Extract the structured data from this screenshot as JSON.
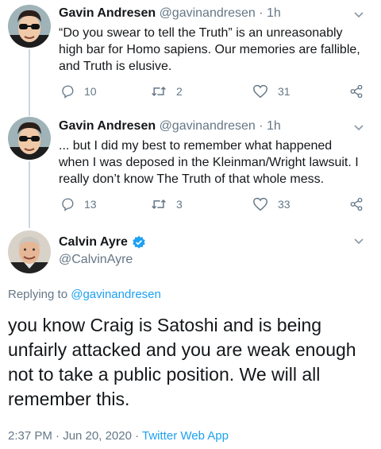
{
  "tweets": [
    {
      "name": "Gavin Andresen",
      "handle": "@gavinandresen",
      "sep": "·",
      "time": "1h",
      "text": "“Do you swear to tell the Truth” is an unreasonably high bar for Homo sapiens. Our memories are fallible, and Truth is elusive.",
      "replies": "10",
      "retweets": "2",
      "likes": "31"
    },
    {
      "name": "Gavin Andresen",
      "handle": "@gavinandresen",
      "sep": "·",
      "time": "1h",
      "text": "... but I did my best to remember what happened when I was deposed in the Kleinman/Wright lawsuit. I really don’t know The Truth of that whole mess.",
      "replies": "13",
      "retweets": "3",
      "likes": "33"
    }
  ],
  "main": {
    "name": "Calvin Ayre",
    "handle": "@CalvinAyre",
    "replying_prefix": "Replying to",
    "replying_to": "@gavinandresen",
    "text": "you know Craig is Satoshi and is being unfairly attacked and you are weak enough not to take a public position.  We will all remember this.",
    "timestamp": "2:37 PM · Jun 20, 2020 ·",
    "source": "Twitter Web App"
  },
  "colors": {
    "accent": "#1da1f2",
    "muted": "#657786",
    "text": "#14171a"
  }
}
